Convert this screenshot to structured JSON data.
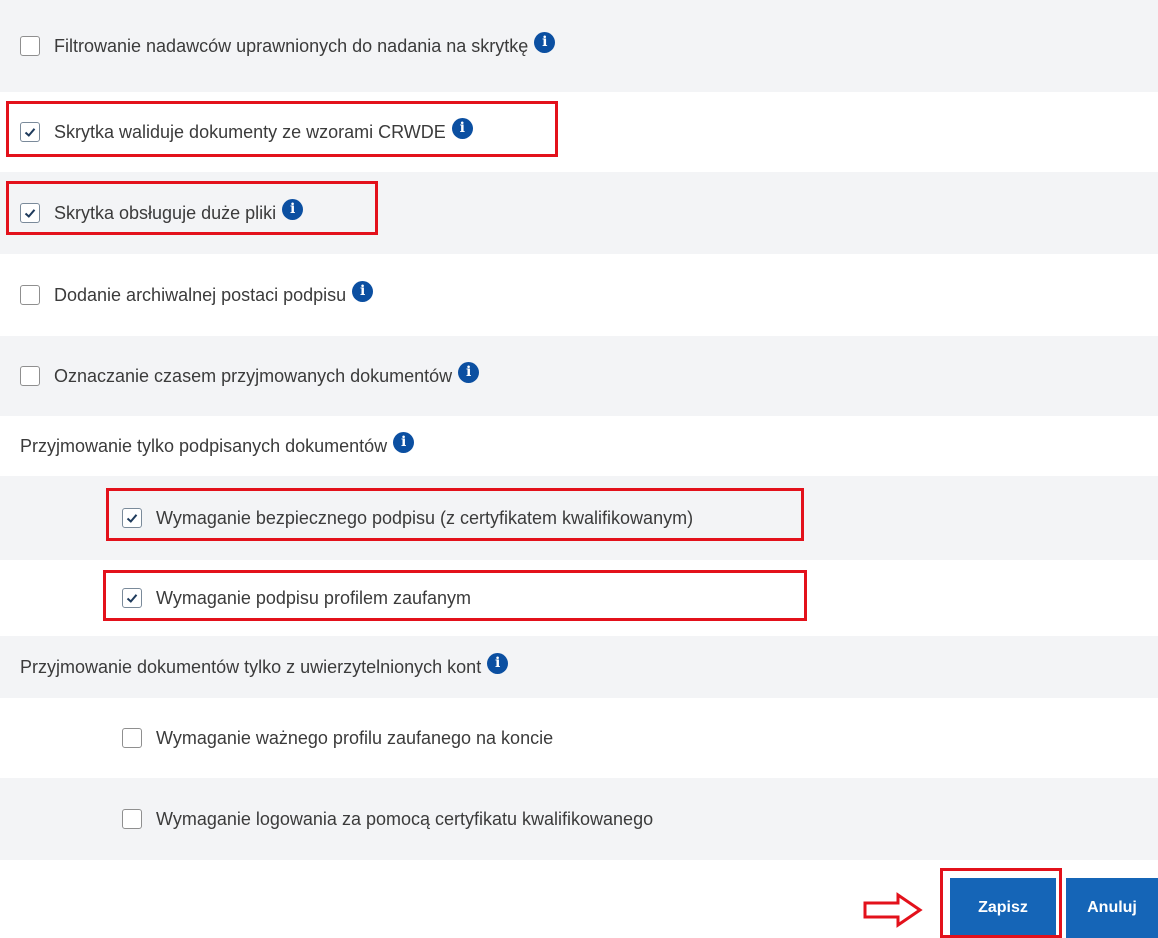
{
  "options": [
    {
      "id": "filtrowanie",
      "label": "Filtrowanie nadawców uprawnionych do nadania na skrytkę",
      "checked": false,
      "info_icon": "info-icon"
    },
    {
      "id": "walidacja",
      "label": "Skrytka waliduje dokumenty ze wzorami CRWDE",
      "checked": true,
      "info_icon": "info-icon"
    },
    {
      "id": "duze-pliki",
      "label": "Skrytka obsługuje duże pliki",
      "checked": true,
      "info_icon": "info-icon"
    },
    {
      "id": "archiwalna",
      "label": "Dodanie archiwalnej postaci podpisu",
      "checked": false,
      "info_icon": "info-icon"
    },
    {
      "id": "czas",
      "label": "Oznaczanie czasem przyjmowanych dokumentów",
      "checked": false,
      "info_icon": "info-icon"
    }
  ],
  "group_signed": {
    "heading": "Przyjmowanie tylko podpisanych dokumentów",
    "items": [
      {
        "label": "Wymaganie bezpiecznego podpisu (z certyfikatem kwalifikowanym)",
        "checked": true
      },
      {
        "label": "Wymaganie podpisu profilem zaufanym",
        "checked": true
      }
    ]
  },
  "group_auth": {
    "heading": "Przyjmowanie dokumentów tylko z uwierzytelnionych kont",
    "items": [
      {
        "label": "Wymaganie ważnego profilu zaufanego na koncie",
        "checked": false
      },
      {
        "label": "Wymaganie logowania za pomocą certyfikatu kwalifikowanego",
        "checked": false
      }
    ]
  },
  "info_glyph": "i",
  "buttons": {
    "save": "Zapisz",
    "cancel": "Anuluj"
  },
  "colors": {
    "highlight": "#e3111b",
    "primary": "#1565b7",
    "info": "#0b4fa1",
    "row_shade": "#f3f4f6"
  }
}
